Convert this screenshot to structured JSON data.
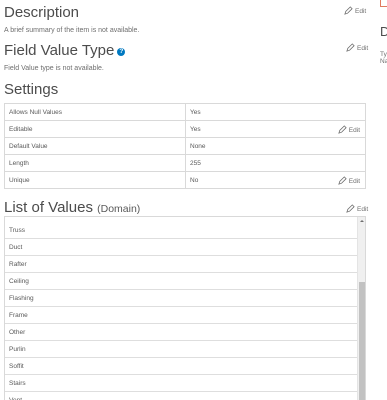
{
  "description": {
    "title": "Description",
    "text": "A brief summary of the item is not available.",
    "edit_label": "Edit"
  },
  "field_value_type": {
    "title": "Field Value Type",
    "help_icon": "?",
    "text": "Field Value type is not available.",
    "edit_label": "Edit"
  },
  "settings": {
    "title": "Settings",
    "rows": [
      {
        "key": "Allows Null Values",
        "value": "Yes",
        "editable": false
      },
      {
        "key": "Editable",
        "value": "Yes",
        "editable": true
      },
      {
        "key": "Default Value",
        "value": "None",
        "editable": false
      },
      {
        "key": "Length",
        "value": "255",
        "editable": false
      },
      {
        "key": "Unique",
        "value": "No",
        "editable": true
      }
    ],
    "edit_label": "Edit"
  },
  "list_of_values": {
    "title": "List of Values",
    "suffix": "(Domain)",
    "edit_label": "Edit",
    "items": [
      "Truss",
      "Duct",
      "Rafter",
      "Ceiling",
      "Flashing",
      "Frame",
      "Other",
      "Purlin",
      "Soffit",
      "Stairs",
      "Vent"
    ]
  },
  "right_panel": {
    "heading_fragment": "D",
    "line1": "Ty",
    "line2": "Na"
  },
  "colors": {
    "accent": "#0079c1",
    "text": "#4c4c4c",
    "border": "#d9d9d9",
    "scroll_thumb": "#c2c2c2"
  },
  "icons": {
    "edit": "pencil-icon",
    "help": "help-icon",
    "scroll_up": "arrow-up-icon"
  }
}
